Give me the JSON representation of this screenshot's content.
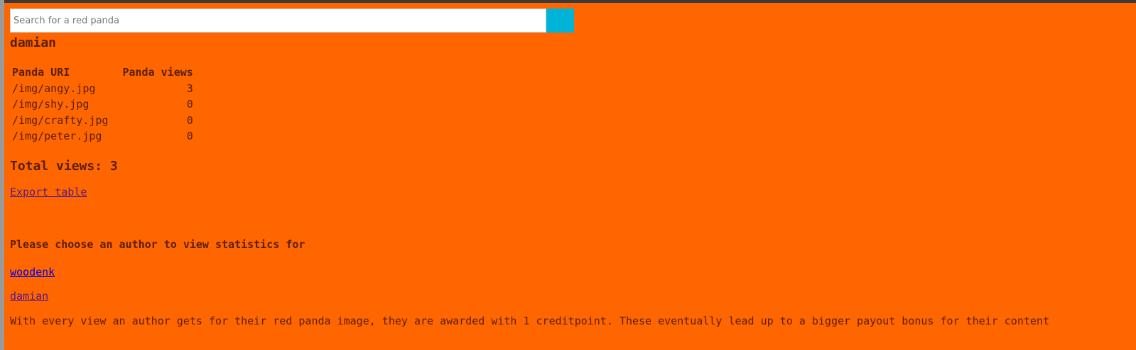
{
  "search": {
    "placeholder": "Search for a red panda",
    "value": "",
    "button_color": "#00b4d8"
  },
  "author": {
    "name": "damian"
  },
  "table": {
    "headers": [
      "Panda URI",
      "Panda views"
    ],
    "rows": [
      {
        "uri": "/img/angy.jpg",
        "views": "3"
      },
      {
        "uri": "/img/shy.jpg",
        "views": "0"
      },
      {
        "uri": "/img/crafty.jpg",
        "views": "0"
      },
      {
        "uri": "/img/peter.jpg",
        "views": "0"
      }
    ]
  },
  "total": {
    "label": "Total views: 3"
  },
  "export": {
    "label": "Export table"
  },
  "choose": {
    "heading": "Please choose an author to view statistics for",
    "authors": [
      "woodenk",
      "damian"
    ]
  },
  "footer": {
    "note": "With every view an author gets for their red panda image, they are awarded with 1 creditpoint. These eventually lead up to a bigger payout bonus for their content"
  },
  "colors": {
    "background": "#ff6600",
    "text": "#5a1e00",
    "link_unvisited": "#0000ee",
    "link_visited": "#551a8b"
  }
}
